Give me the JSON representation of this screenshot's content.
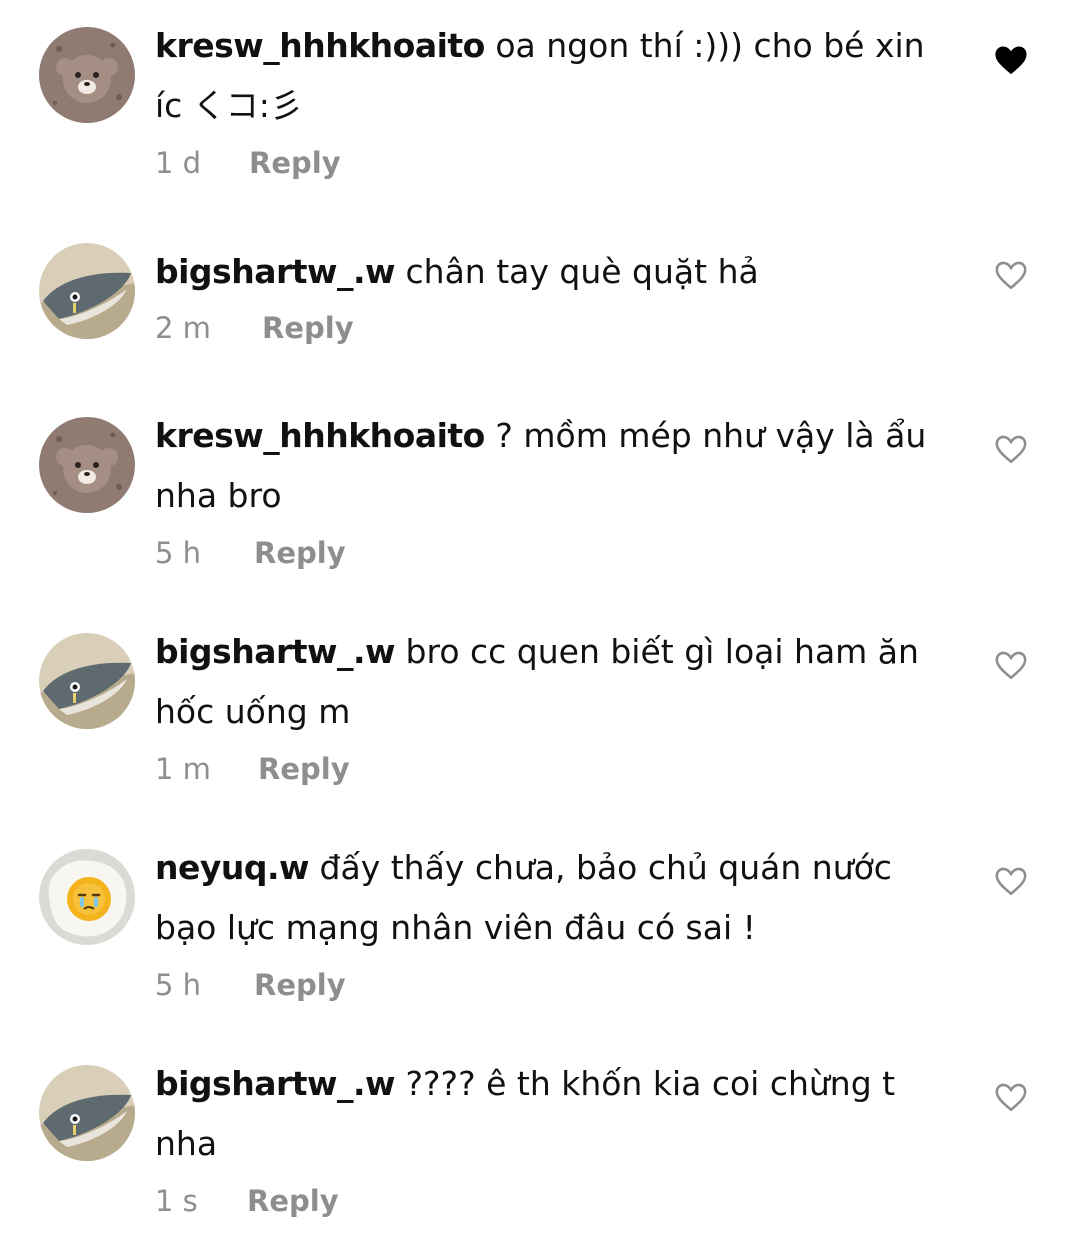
{
  "comments": [
    {
      "avatar": "bear-avatar",
      "username": "kresw_hhhkhoaito",
      "text": "oa ngon thí :))) cho bé xin íc くコ:彡",
      "time": "1 d",
      "reply": "Reply",
      "liked": true
    },
    {
      "avatar": "shark-avatar",
      "username": "bigshartw_.w",
      "text": "chân tay què quặt hả",
      "time": "2 m",
      "reply": "Reply",
      "liked": false
    },
    {
      "avatar": "bear-avatar",
      "username": "kresw_hhhkhoaito",
      "text": "? mồm mép như vậy là ẩu nha bro",
      "time": "5 h",
      "reply": "Reply",
      "liked": false
    },
    {
      "avatar": "shark-avatar",
      "username": "bigshartw_.w",
      "text": "bro cc quen biết gì loại ham ăn hốc uống m",
      "time": "1 m",
      "reply": "Reply",
      "liked": false
    },
    {
      "avatar": "egg-avatar",
      "username": "neyuq.w",
      "text": "đấy thấy chưa, bảo chủ quán nước bạo lực mạng nhân viên đâu có sai !",
      "time": "5 h",
      "reply": "Reply",
      "liked": false
    },
    {
      "avatar": "shark-avatar",
      "username": "bigshartw_.w",
      "text": "???? ê th khốn kia coi chừng t nha",
      "time": "1 s",
      "reply": "Reply",
      "liked": false
    }
  ]
}
